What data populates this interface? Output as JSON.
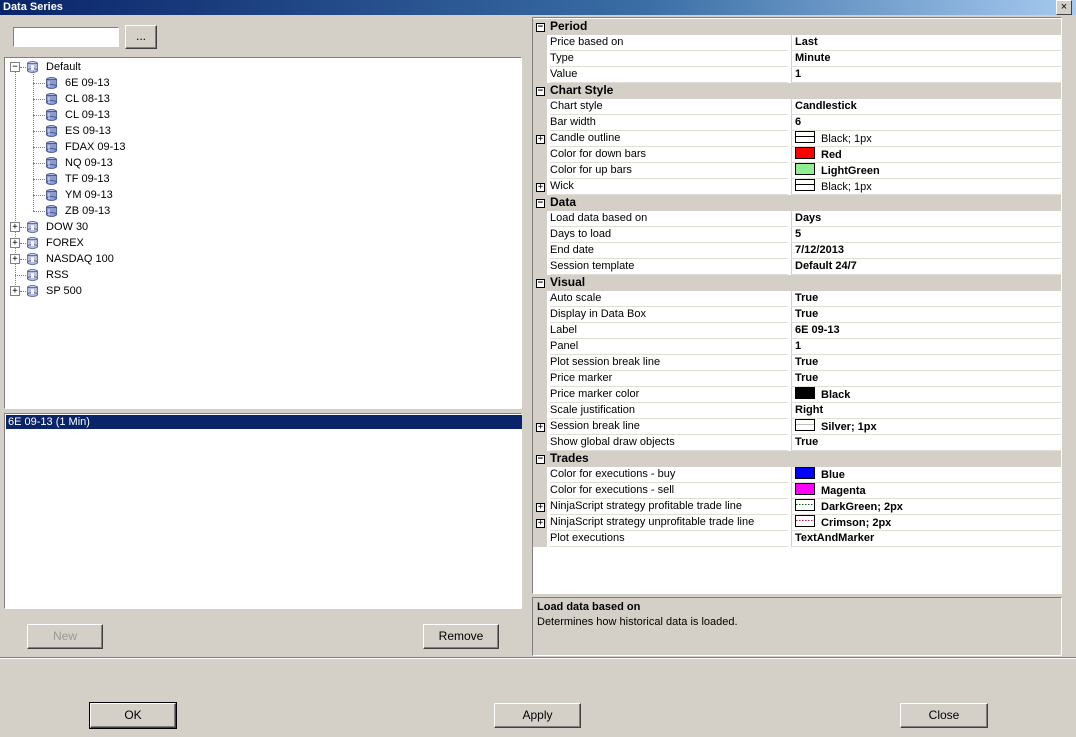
{
  "window": {
    "title": "Data Series",
    "close_glyph": "×"
  },
  "search": {
    "value": "",
    "browse_label": "..."
  },
  "tree": {
    "root": {
      "label": "Default",
      "expanded": true,
      "glyph": "−"
    },
    "children": [
      "6E 09-13",
      "CL 08-13",
      "CL 09-13",
      "ES 09-13",
      "FDAX 09-13",
      "NQ 09-13",
      "TF 09-13",
      "YM 09-13",
      "ZB 09-13"
    ],
    "groups": [
      {
        "label": "DOW 30",
        "glyph": "+"
      },
      {
        "label": "FOREX",
        "glyph": "+"
      },
      {
        "label": "NASDAQ 100",
        "glyph": "+"
      },
      {
        "label": "RSS",
        "glyph": ""
      },
      {
        "label": "SP 500",
        "glyph": "+"
      }
    ]
  },
  "selected_series": "6E 09-13 (1 Min)",
  "buttons": {
    "new": "New",
    "remove": "Remove",
    "ok": "OK",
    "apply": "Apply",
    "close": "Close"
  },
  "properties": {
    "period": {
      "title": "Period",
      "rows": [
        {
          "name": "Price based on",
          "value": "Last"
        },
        {
          "name": "Type",
          "value": "Minute"
        },
        {
          "name": "Value",
          "value": "1"
        }
      ]
    },
    "chart_style": {
      "title": "Chart Style",
      "rows": [
        {
          "name": "Chart style",
          "value": "Candlestick"
        },
        {
          "name": "Bar width",
          "value": "6"
        },
        {
          "name": "Candle outline",
          "value": "Black; 1px",
          "expand": "+",
          "swatch": "line",
          "swatch_color": "#000000",
          "normal": true
        },
        {
          "name": "Color for down bars",
          "value": "Red",
          "swatch": "fill",
          "swatch_color": "#ff0000"
        },
        {
          "name": "Color for up bars",
          "value": "LightGreen",
          "swatch": "fill",
          "swatch_color": "#90ee90"
        },
        {
          "name": "Wick",
          "value": "Black; 1px",
          "expand": "+",
          "swatch": "line",
          "swatch_color": "#000000",
          "normal": true
        }
      ]
    },
    "data": {
      "title": "Data",
      "rows": [
        {
          "name": "Load data based on",
          "value": "Days"
        },
        {
          "name": "Days to load",
          "value": "5"
        },
        {
          "name": "End date",
          "value": "7/12/2013"
        },
        {
          "name": "Session template",
          "value": "Default 24/7"
        }
      ]
    },
    "visual": {
      "title": "Visual",
      "rows": [
        {
          "name": "Auto scale",
          "value": "True"
        },
        {
          "name": "Display in Data Box",
          "value": "True"
        },
        {
          "name": "Label",
          "value": "6E 09-13"
        },
        {
          "name": "Panel",
          "value": "1"
        },
        {
          "name": "Plot session break line",
          "value": "True"
        },
        {
          "name": "Price marker",
          "value": "True"
        },
        {
          "name": "Price marker color",
          "value": "Black",
          "swatch": "fill",
          "swatch_color": "#000000"
        },
        {
          "name": "Scale justification",
          "value": "Right"
        },
        {
          "name": "Session break line",
          "value": "Silver; 1px",
          "expand": "+",
          "swatch": "line",
          "swatch_color": "#c0c0c0"
        },
        {
          "name": "Show global draw objects",
          "value": "True"
        }
      ]
    },
    "trades": {
      "title": "Trades",
      "rows": [
        {
          "name": "Color for executions - buy",
          "value": "Blue",
          "swatch": "fill",
          "swatch_color": "#0000ff"
        },
        {
          "name": "Color for executions - sell",
          "value": "Magenta",
          "swatch": "fill",
          "swatch_color": "#ff00ff"
        },
        {
          "name": "NinjaScript strategy profitable trade line",
          "value": "DarkGreen; 2px",
          "expand": "+",
          "swatch": "dots",
          "swatch_color": "#006400"
        },
        {
          "name": "NinjaScript strategy unprofitable trade line",
          "value": "Crimson; 2px",
          "expand": "+",
          "swatch": "dots",
          "swatch_color": "#dc143c"
        },
        {
          "name": "Plot executions",
          "value": "TextAndMarker"
        }
      ]
    }
  },
  "description": {
    "title": "Load data based on",
    "text": "Determines how historical data is loaded."
  }
}
